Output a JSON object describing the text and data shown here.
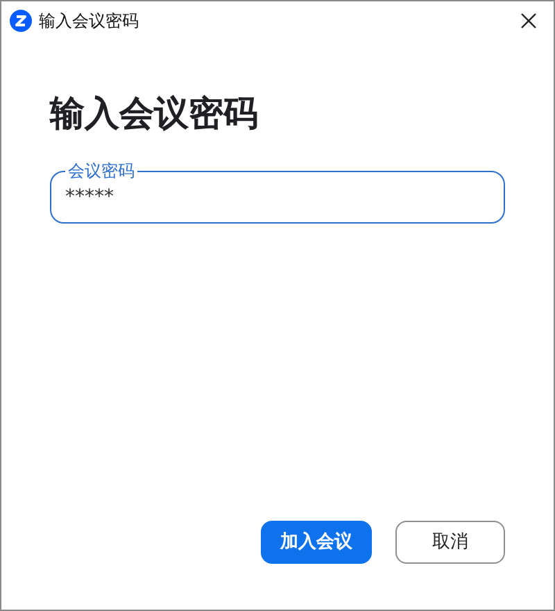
{
  "window": {
    "title": "输入会议密码"
  },
  "heading": "输入会议密码",
  "password_field": {
    "label": "会议密码",
    "value": "*****"
  },
  "buttons": [
    {
      "label": "加入会议",
      "kind": "primary"
    },
    {
      "label": "取消",
      "kind": "secondary"
    }
  ]
}
